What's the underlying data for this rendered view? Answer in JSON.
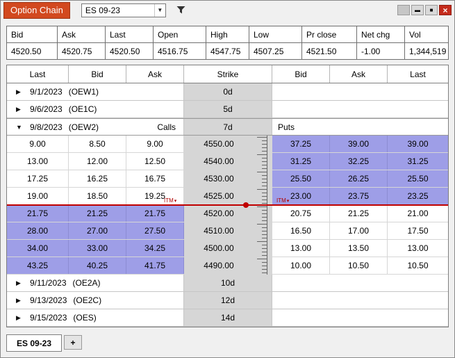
{
  "window": {
    "title": "Option Chain",
    "symbol": "ES 09-23",
    "controls": {
      "minimize": "▬",
      "maximize": "■",
      "close": "×"
    }
  },
  "colors": {
    "title_badge": "#d2491f",
    "itm_highlight": "#9e9ee7",
    "price_line": "#c00000",
    "strike_column": "#d6d6d6",
    "close_button": "#c42b1c"
  },
  "quote": {
    "headers": [
      "Bid",
      "Ask",
      "Last",
      "Open",
      "High",
      "Low",
      "Pr close",
      "Net chg",
      "Vol"
    ],
    "values": [
      "4520.50",
      "4520.75",
      "4520.50",
      "4516.75",
      "4547.75",
      "4507.25",
      "4521.50",
      "-1.00",
      "1,344,519"
    ]
  },
  "chain": {
    "headers": [
      "Last",
      "Bid",
      "Ask",
      "Strike",
      "Bid",
      "Ask",
      "Last"
    ],
    "itm_label": "ITM",
    "groups": [
      {
        "date": "9/1/2023",
        "code": "(OEW1)",
        "days": "0d"
      },
      {
        "date": "9/6/2023",
        "code": "(OE1C)",
        "days": "5d"
      },
      {
        "date": "9/8/2023",
        "code": "(OEW2)",
        "days": "7d",
        "calls_label": "Calls",
        "puts_label": "Puts",
        "rows": [
          {
            "c": [
              "9.00",
              "8.50",
              "9.00"
            ],
            "strike": "4550.00",
            "p": [
              "37.25",
              "39.00",
              "39.00"
            ]
          },
          {
            "c": [
              "13.00",
              "12.00",
              "12.50"
            ],
            "strike": "4540.00",
            "p": [
              "31.25",
              "32.25",
              "31.25"
            ]
          },
          {
            "c": [
              "17.25",
              "16.25",
              "16.75"
            ],
            "strike": "4530.00",
            "p": [
              "25.50",
              "26.25",
              "25.50"
            ]
          },
          {
            "c": [
              "19.00",
              "18.50",
              "19.25"
            ],
            "strike": "4525.00",
            "p": [
              "23.00",
              "23.75",
              "23.25"
            ]
          },
          {
            "c": [
              "21.75",
              "21.25",
              "21.75"
            ],
            "strike": "4520.00",
            "p": [
              "20.75",
              "21.25",
              "21.00"
            ]
          },
          {
            "c": [
              "28.00",
              "27.00",
              "27.50"
            ],
            "strike": "4510.00",
            "p": [
              "16.50",
              "17.00",
              "17.50"
            ]
          },
          {
            "c": [
              "34.00",
              "33.00",
              "34.25"
            ],
            "strike": "4500.00",
            "p": [
              "13.00",
              "13.50",
              "13.00"
            ]
          },
          {
            "c": [
              "43.25",
              "40.25",
              "41.75"
            ],
            "strike": "4490.00",
            "p": [
              "10.00",
              "10.50",
              "10.50"
            ]
          }
        ]
      },
      {
        "date": "9/11/2023",
        "code": "(OE2A)",
        "days": "10d"
      },
      {
        "date": "9/13/2023",
        "code": "(OE2C)",
        "days": "12d"
      },
      {
        "date": "9/15/2023",
        "code": "(OES)",
        "days": "14d"
      }
    ]
  },
  "tabs": {
    "active": "ES 09-23",
    "add": "+"
  },
  "icons": {
    "collapsed": "▶",
    "expanded": "▼",
    "dropdown_arrow": "▼",
    "itm_marker": "▾"
  }
}
